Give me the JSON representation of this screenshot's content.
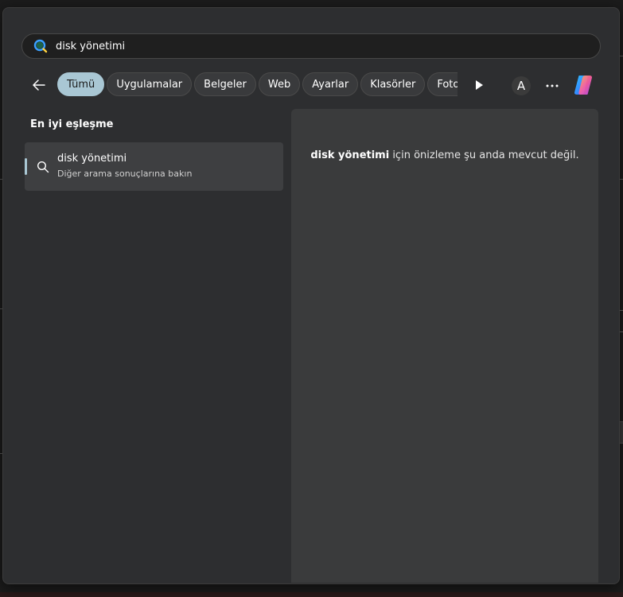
{
  "search": {
    "query": "disk yönetimi",
    "placeholder": ""
  },
  "filters": {
    "chips": [
      "Tümü",
      "Uygulamalar",
      "Belgeler",
      "Web",
      "Ayarlar",
      "Klasörler",
      "Fotoğ"
    ],
    "active_index": 0
  },
  "account": {
    "initial": "A"
  },
  "best_match": {
    "heading": "En iyi eşleşme",
    "title": "disk yönetimi",
    "subtitle": "Diğer arama sonuçlarına bakın"
  },
  "preview": {
    "query_bold": "disk yönetimi",
    "message": " için önizleme şu anda mevcut değil."
  },
  "colors": {
    "accent": "#a9c7d4",
    "panel_bg": "#2d2e30",
    "preview_bg": "#3a3b3c",
    "item_selected_bg": "#3e3f41"
  }
}
